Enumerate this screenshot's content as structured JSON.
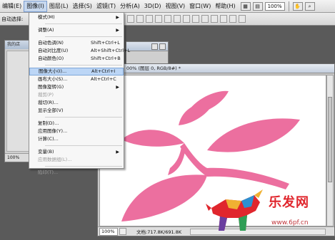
{
  "menubar": {
    "items": [
      "编辑(E)",
      "图像(I)",
      "图层(L)",
      "选择(S)",
      "滤镜(T)",
      "分析(A)",
      "3D(D)",
      "视图(V)",
      "窗口(W)",
      "帮助(H)"
    ],
    "zoom": "100%"
  },
  "optbar": {
    "auto_select": "自动选择:"
  },
  "small_window": {
    "title": "我的店",
    "status": "100%"
  },
  "doc_window": {
    "title": "00% (图层 0, RGB/8#) *",
    "zoom": "100%",
    "doc_info": "文档:717.8K/691.8K"
  },
  "image_menu": {
    "mode": "模式(M)",
    "adjust": "调整(A)",
    "auto_tone": {
      "label": "自动色调(N)",
      "shortcut": "Shift+Ctrl+L"
    },
    "auto_contrast": {
      "label": "自动对比度(U)",
      "shortcut": "Alt+Shift+Ctrl+L"
    },
    "auto_color": {
      "label": "自动颜色(O)",
      "shortcut": "Shift+Ctrl+B"
    },
    "image_size": {
      "label": "图像大小(I)...",
      "shortcut": "Alt+Ctrl+I"
    },
    "canvas_size": {
      "label": "画布大小(S)...",
      "shortcut": "Alt+Ctrl+C"
    },
    "image_rotation": "图像旋转(G)",
    "crop": "裁剪(P)",
    "trim": "裁切(R)...",
    "reveal_all": "显示全部(V)",
    "duplicate": "复制(D)...",
    "apply_image": "应用图像(Y)...",
    "calculations": "计算(C)...",
    "variables": "变量(B)",
    "apply_data_set": "应用数据组(L)...",
    "trap": "陷印(T)..."
  },
  "watermark": {
    "brand": "乐发网",
    "site": "www.6pf.cn"
  },
  "colors": {
    "flower": "#ec6f9f",
    "menu_highlight": "#bcd6f6",
    "brand_red": "#e0262d"
  }
}
